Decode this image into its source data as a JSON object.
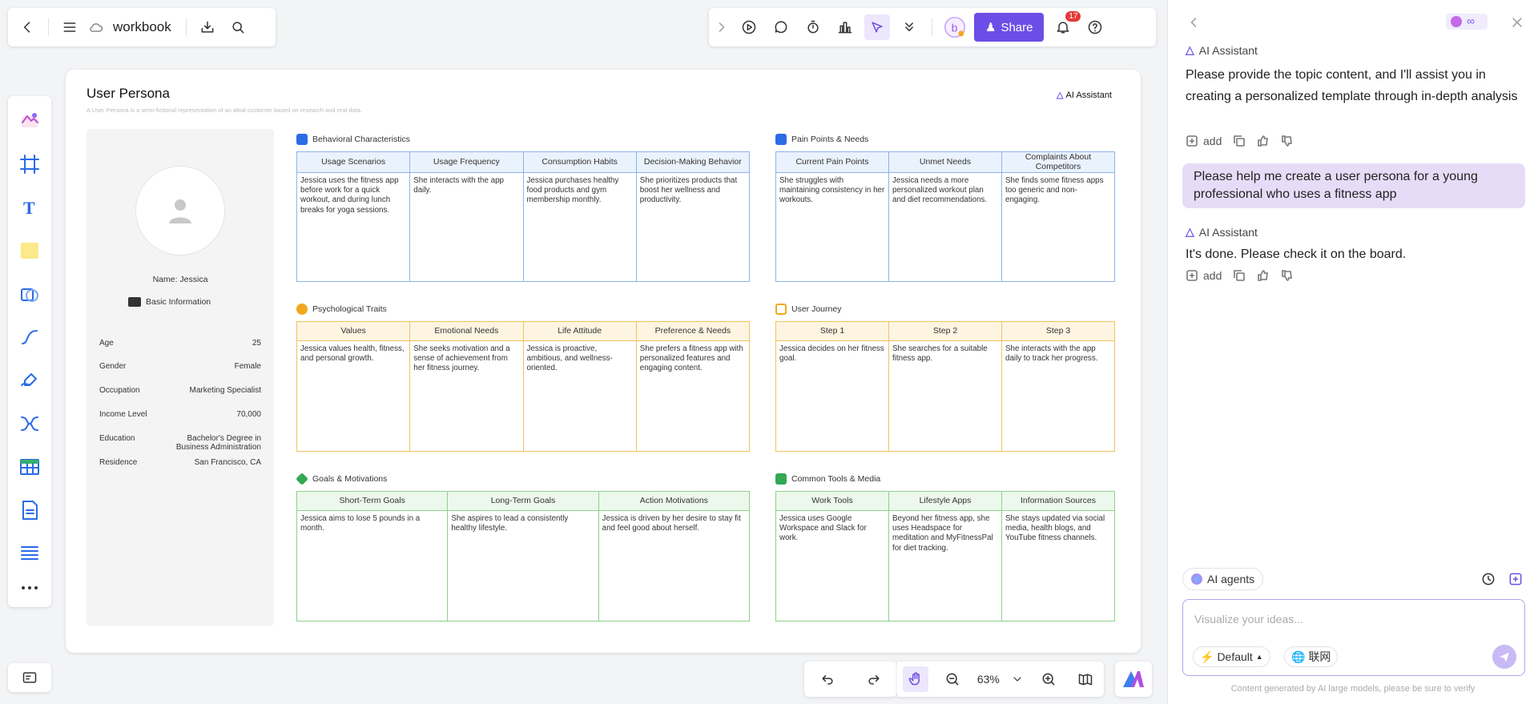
{
  "toolbar_left": {
    "title": "workbook"
  },
  "toolbar_right": {
    "share_label": "Share",
    "notifications": "17"
  },
  "canvas": {
    "title": "User Persona",
    "subtitle": "A User Persona is a semi-fictional representation of an ideal customer based on research and real data.",
    "ai_tag": "AI Assistant",
    "profile": {
      "name": "Name: Jessica",
      "basic_info": "Basic Information",
      "fields": [
        {
          "k": "Age",
          "v": "25"
        },
        {
          "k": "Gender",
          "v": "Female"
        },
        {
          "k": "Occupation",
          "v": "Marketing Specialist"
        },
        {
          "k": "Income Level",
          "v": "70,000"
        },
        {
          "k": "Education",
          "v": "Bachelor's Degree in Business Administration"
        },
        {
          "k": "Residence",
          "v": "San Francisco, CA"
        }
      ]
    },
    "sections": {
      "behavioral": {
        "title": "Behavioral Characteristics",
        "headers": [
          "Usage Scenarios",
          "Usage Frequency",
          "Consumption Habits",
          "Decision-Making Behavior"
        ],
        "cells": [
          "Jessica uses the fitness app before work for a quick workout, and during lunch breaks for yoga sessions.",
          "She interacts with the app daily.",
          "Jessica purchases healthy food products and gym membership monthly.",
          "She prioritizes products that boost her wellness and productivity."
        ]
      },
      "pain": {
        "title": "Pain Points & Needs",
        "headers": [
          "Current Pain Points",
          "Unmet Needs",
          "Complaints About Competitors"
        ],
        "cells": [
          "She struggles with maintaining consistency in her workouts.",
          "Jessica needs a more personalized workout plan and diet recommendations.",
          "She finds some fitness apps too generic and non-engaging."
        ]
      },
      "psych": {
        "title": "Psychological Traits",
        "headers": [
          "Values",
          "Emotional Needs",
          "Life Attitude",
          "Preference & Needs"
        ],
        "cells": [
          "Jessica values health, fitness, and personal growth.",
          "She seeks motivation and a sense of achievement from her fitness journey.",
          "Jessica is proactive, ambitious, and wellness-oriented.",
          "She prefers a fitness app with personalized features and engaging content."
        ]
      },
      "journey": {
        "title": "User Journey",
        "headers": [
          "Step 1",
          "Step 2",
          "Step 3"
        ],
        "cells": [
          "Jessica decides on her fitness goal.",
          "She searches for a suitable fitness app.",
          "She interacts with the app daily to track her progress."
        ]
      },
      "goals": {
        "title": "Goals & Motivations",
        "headers": [
          "Short-Term Goals",
          "Long-Term Goals",
          "Action Motivations"
        ],
        "cells": [
          "Jessica aims to lose 5 pounds in a month.",
          "She aspires to lead a consistently healthy lifestyle.",
          "Jessica is driven by her desire to stay fit and feel good about herself."
        ]
      },
      "tools": {
        "title": "Common Tools & Media",
        "headers": [
          "Work Tools",
          "Lifestyle Apps",
          "Information Sources"
        ],
        "cells": [
          "Jessica uses Google Workspace and Slack for work.",
          "Beyond her fitness app, she uses Headspace for meditation and MyFitnessPal for diet tracking.",
          "She stays updated via social media, health blogs, and YouTube fitness channels."
        ]
      }
    }
  },
  "zoom": "63%",
  "assistant": {
    "name": "AI Assistant",
    "msg1": "Please provide the topic content, and I'll assist you in creating a personalized template through in-depth analysis",
    "add_label": "add",
    "user_msg": "Please help me create a user persona for a young professional who uses a fitness app",
    "msg2": "It's done. Please check it on the board.",
    "agents_label": "AI agents",
    "input_placeholder": "Visualize your ideas...",
    "mode_label": "Default",
    "web_label": "联网",
    "footer": "Content generated by AI large models, please be sure to verify"
  },
  "colors": {
    "accent": "#6c4ee6",
    "blue": "#8fb3e8",
    "yellow": "#f0c25e",
    "green": "#8fd08a"
  }
}
